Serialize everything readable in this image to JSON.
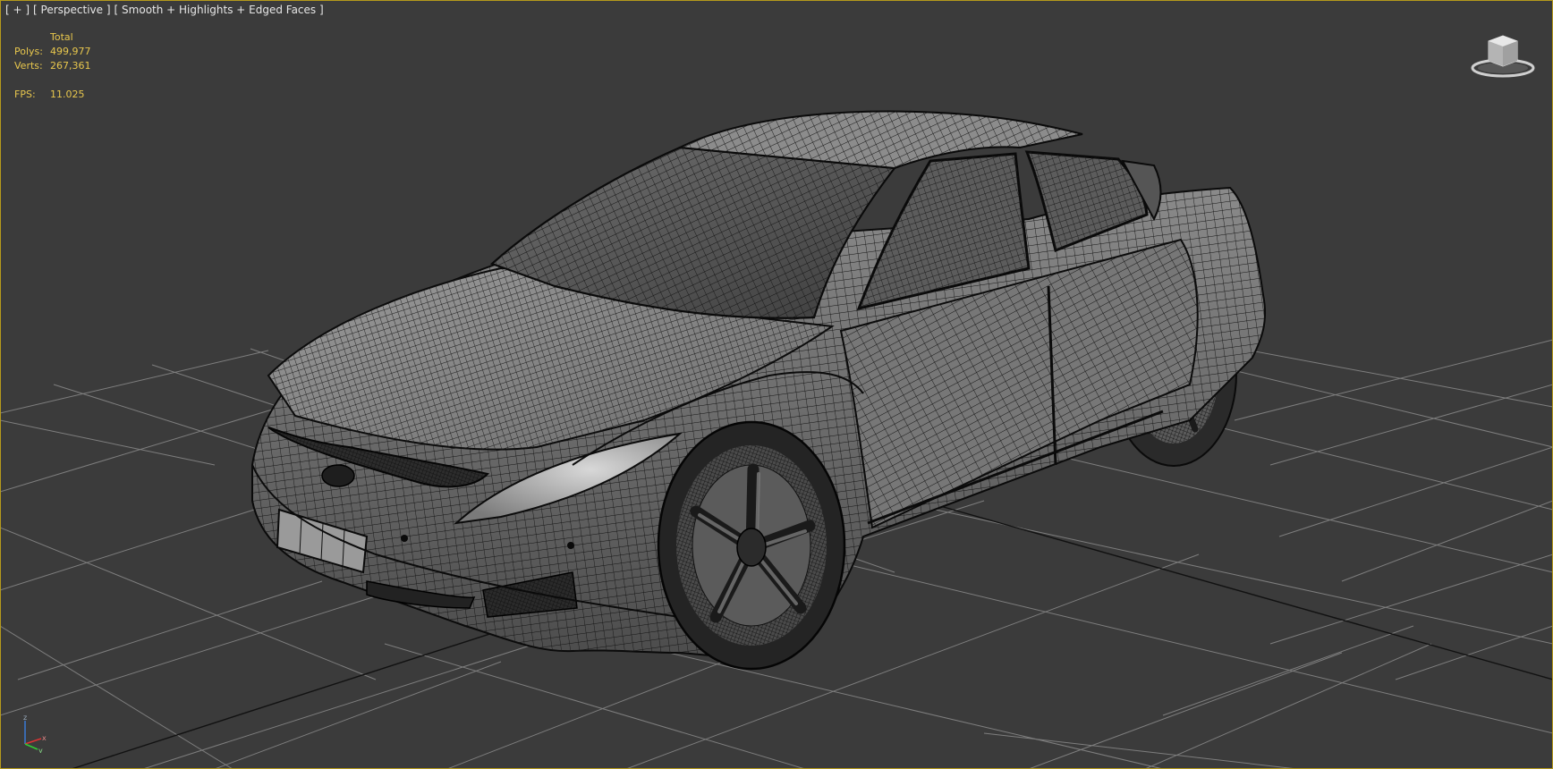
{
  "viewport": {
    "label_menu": "[ + ]",
    "label_view": "[ Perspective ]",
    "label_shading": "[ Smooth + Highlights + Edged Faces ]"
  },
  "stats": {
    "header": "Total",
    "polys_label": "Polys:",
    "polys_value": "499,977",
    "verts_label": "Verts:",
    "verts_value": "267,361",
    "fps_label": "FPS:",
    "fps_value": "11.025"
  },
  "axis": {
    "z_label": "z",
    "x_label": "x",
    "y_label": "y"
  },
  "colors": {
    "viewport_bg": "#3b3b3b",
    "active_border": "#b59a1c",
    "stats_text": "#e8c74d",
    "label_text": "#e6e6e6",
    "grid_line": "#8a8a8a",
    "grid_axis": "#111111"
  },
  "icons": {
    "viewcube": "viewcube-icon",
    "axis_tripod": "axis-tripod-icon"
  }
}
